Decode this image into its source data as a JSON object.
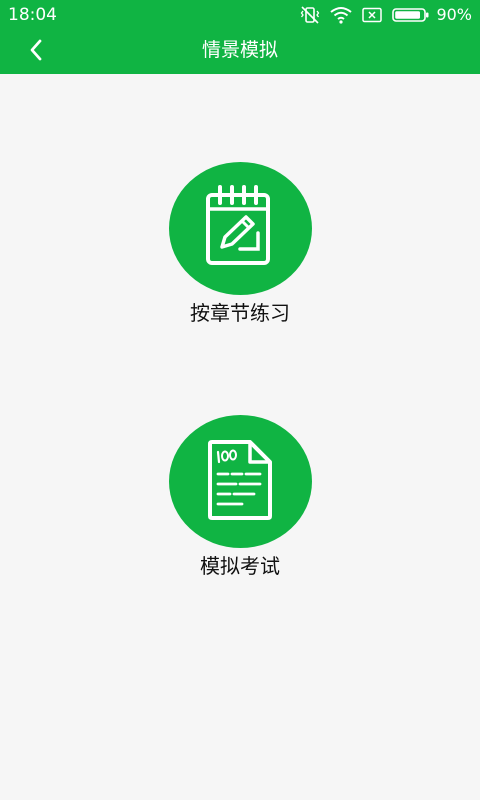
{
  "status_bar": {
    "time": "18:04",
    "battery_percent": "90%",
    "icons": [
      "vibrate-mute-icon",
      "wifi-icon",
      "sim-off-icon",
      "battery-icon"
    ],
    "battery_level": 0.9
  },
  "app_bar": {
    "title": "情景模拟",
    "back_icon": "chevron-left-icon",
    "color": "#10b443"
  },
  "menu": {
    "items": [
      {
        "label": "按章节练习",
        "icon": "notepad-pencil-icon"
      },
      {
        "label": "模拟考试",
        "icon": "exam-paper-icon"
      }
    ]
  },
  "colors": {
    "primary": "#10b443",
    "background": "#f6f6f6",
    "text": "#111111"
  }
}
